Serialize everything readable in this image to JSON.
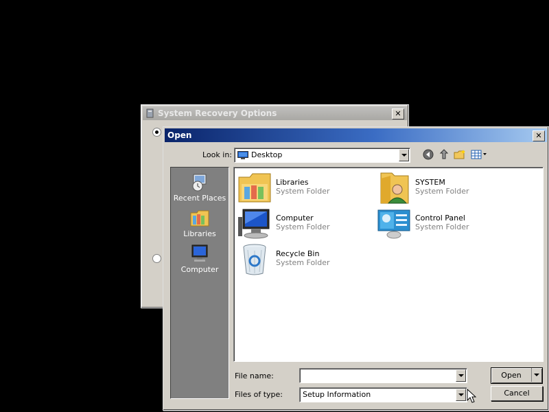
{
  "background_window": {
    "title": "System Recovery Options",
    "close_label": "✕",
    "radio_options": [
      {
        "selected": true
      },
      {
        "selected": false
      }
    ]
  },
  "dialog": {
    "title": "Open",
    "close_label": "✕",
    "look_in_label": "Look in:",
    "look_in_value": "Desktop",
    "toolbar": [
      "back-icon",
      "up-folder-icon",
      "new-folder-icon",
      "view-menu-icon"
    ],
    "places": [
      {
        "label": "Recent Places",
        "icon": "recent-places-icon"
      },
      {
        "label": "Libraries",
        "icon": "libraries-icon"
      },
      {
        "label": "Computer",
        "icon": "computer-icon"
      }
    ],
    "items": [
      {
        "name": "Libraries",
        "type": "System Folder",
        "icon": "libraries-icon"
      },
      {
        "name": "SYSTEM",
        "type": "System Folder",
        "icon": "user-folder-icon"
      },
      {
        "name": "Computer",
        "type": "System Folder",
        "icon": "computer-icon"
      },
      {
        "name": "Control Panel",
        "type": "System Folder",
        "icon": "control-panel-icon"
      },
      {
        "name": "Recycle Bin",
        "type": "System Folder",
        "icon": "recycle-bin-icon"
      }
    ],
    "file_name_label": "File name:",
    "file_name_value": "",
    "files_of_type_label": "Files of type:",
    "files_of_type_value": "Setup Information",
    "open_button": "Open",
    "cancel_button": "Cancel"
  },
  "colors": {
    "active_title_start": "#0a246a",
    "active_title_end": "#a6caf0",
    "face": "#d4d0c8",
    "places_bar": "#808080"
  }
}
